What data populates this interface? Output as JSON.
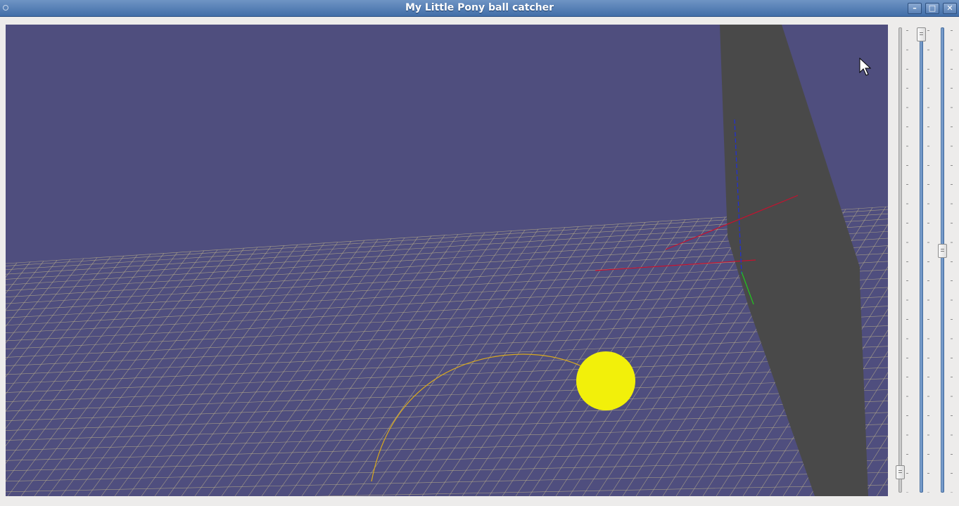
{
  "window": {
    "title": "My Little Pony ball catcher",
    "controls": {
      "minimize_icon": "minimize-icon",
      "maximize_icon": "maximize-icon",
      "close_icon": "close-icon"
    }
  },
  "scene": {
    "sky_color": "#4f4e7e",
    "floor_color": "#4f4e7e",
    "grid_color": "#c2b78a",
    "wall_color": "#494949",
    "ball_color": "#f2f00a",
    "trajectory_color": "#d8a91f",
    "axis_x_color": "#c8102e",
    "axis_y_color": "#1fc81f",
    "axis_z_color": "#1f2fd8"
  },
  "sliders": [
    {
      "name": "slider-1",
      "value": 0.03
    },
    {
      "name": "slider-2",
      "value": 1.0
    },
    {
      "name": "slider-3",
      "value": 0.52
    }
  ]
}
